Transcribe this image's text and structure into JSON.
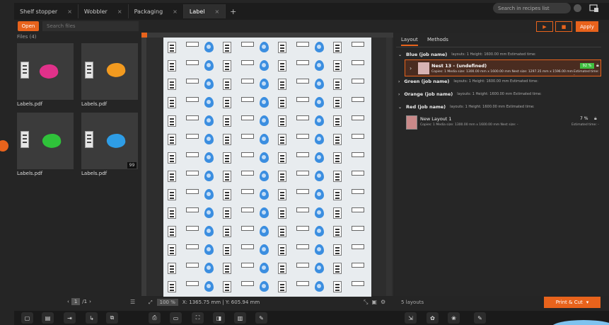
{
  "tabs": [
    {
      "label": "Shelf stopper",
      "active": false
    },
    {
      "label": "Wobbler",
      "active": false
    },
    {
      "label": "Packaging",
      "active": false
    },
    {
      "label": "Label",
      "active": true
    }
  ],
  "tab_close": "×",
  "tab_add": "+",
  "recipe_search_placeholder": "Search in recipes list",
  "open_label": "Open",
  "search_files_placeholder": "Search files",
  "files_title": "Files (4)",
  "files": [
    {
      "name": "Labels.pdf",
      "blob_color": "#e0318a"
    },
    {
      "name": "Labels.pdf",
      "blob_color": "#f29a1f"
    },
    {
      "name": "Labels.pdf",
      "blob_color": "#2fc23a"
    },
    {
      "name": "Labels.pdf",
      "blob_color": "#2e9de6"
    }
  ],
  "file_badge": "99",
  "pager": {
    "current": "1",
    "total": "/1"
  },
  "canvas": {
    "zoom": "100 %",
    "coords": "X: 1365.75 mm | Y: 605.94 mm"
  },
  "right_tabs": [
    "Layout",
    "Methods"
  ],
  "run_icon": "▶",
  "stop_icon": "■",
  "apply_label": "Apply",
  "groups": [
    {
      "name": "Blue (job name)",
      "meta": "layouts: 1    Height: 1600.00 mm    Estimated time:"
    },
    {
      "name": "Green (job name)",
      "meta": "layouts: 1    Height: 1600.00 mm    Estimated time:"
    },
    {
      "name": "Orange (job name)",
      "meta": "layouts: 1    Height: 1600.00 mm    Estimated time:"
    },
    {
      "name": "Red (job name)",
      "meta": "layouts: 1    Height: 1600.00 mm    Estimated time:"
    }
  ],
  "nest": {
    "title": "Nest 13 - (undefined)",
    "meta": "Copies: 1    Media size: 1300.00 mm x 1600.00 mm         Nest size: 1297.35 mm x 1596.00 mm",
    "percent": "92 %",
    "est": "Estimated time: -"
  },
  "new_layout": {
    "title": "New Layout 1",
    "meta": "Copies: 1    Media size: 1300.00 mm x 1600.00 mm                 Nest size: -",
    "percent": "7 %",
    "est": "Estimated time: -"
  },
  "layouts_count": "5 layouts",
  "print_label": "Print & Cut",
  "colors": {
    "accent": "#e8631c",
    "nest_bg": "#4a2c20",
    "progress": "#3fbf3f",
    "drop": "#3b8ee0"
  }
}
